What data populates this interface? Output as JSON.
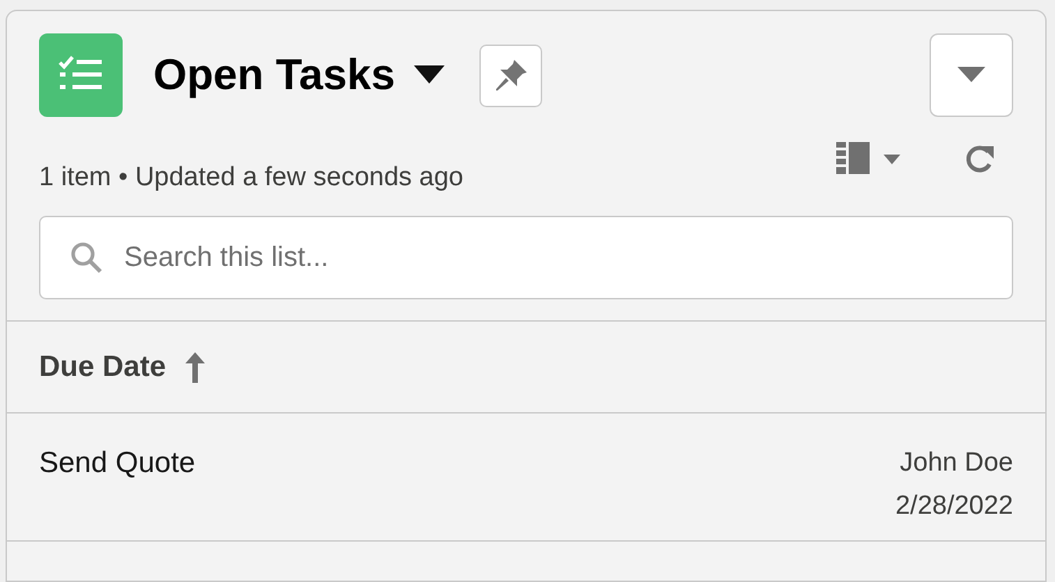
{
  "header": {
    "title": "Open Tasks",
    "subtitle": "1 item • Updated a few seconds ago"
  },
  "search": {
    "placeholder": "Search this list..."
  },
  "table": {
    "columns": [
      {
        "label": "Due Date",
        "sort_ascending": true
      }
    ],
    "rows": [
      {
        "subject": "Send Quote",
        "assignee": "John Doe",
        "due": "2/28/2022"
      }
    ]
  }
}
